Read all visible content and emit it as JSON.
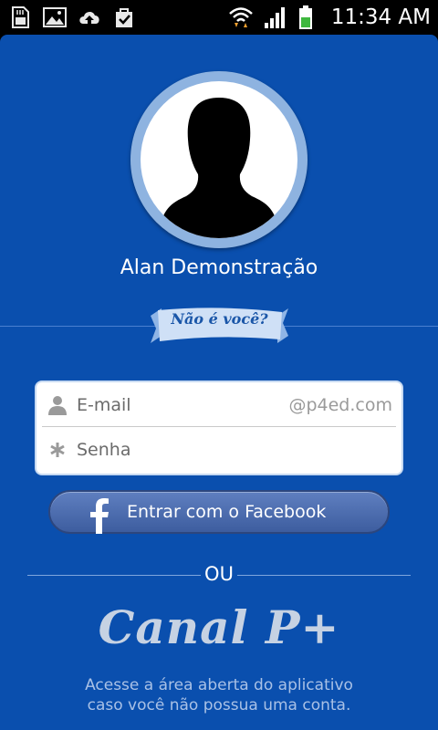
{
  "status_bar": {
    "time": "11:34 AM",
    "left_icons": [
      "sd-card-icon",
      "image-icon",
      "cloud-upload-icon",
      "clipboard-check-icon"
    ],
    "right_icons": [
      "wifi-icon",
      "signal-icon",
      "battery-icon"
    ]
  },
  "profile": {
    "name": "Alan Demonstração",
    "not_you_label": "Não é você?"
  },
  "login_form": {
    "email_placeholder": "E-mail",
    "email_domain": "@p4ed.com",
    "password_placeholder": "Senha"
  },
  "facebook_button": {
    "label": "Entrar com o Facebook"
  },
  "separator": {
    "label": "OU"
  },
  "brand": {
    "name": "Canal P+"
  },
  "info": {
    "line1": "Acesse a área aberta do aplicativo",
    "line2": "caso você não possua uma conta."
  },
  "colors": {
    "background": "#0a4fae",
    "facebook": "#3d5d9f",
    "brand_text": "#c6d2e3"
  }
}
